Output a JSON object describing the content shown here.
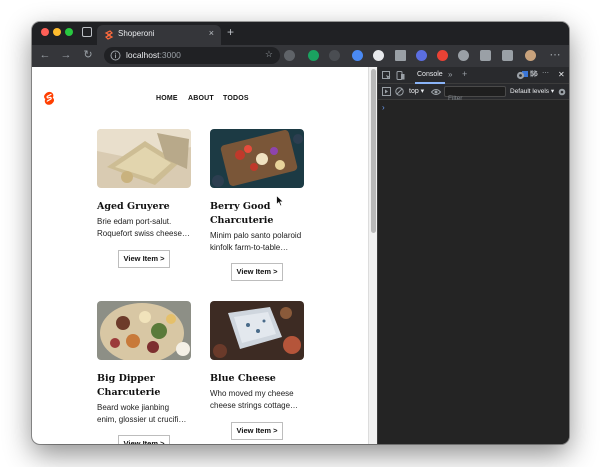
{
  "browser": {
    "tab_title": "Shoperoni",
    "tab_close": "×",
    "new_tab": "+",
    "url_host": "localhost",
    "url_port": ":3000"
  },
  "site": {
    "nav": [
      "HOME",
      "ABOUT",
      "TODOS"
    ],
    "cards": [
      {
        "title": "Aged Gruyere",
        "desc_line1": "Brie edam port-salut.",
        "desc_line2": "Roquefort swiss cheese…",
        "button": "View Item >"
      },
      {
        "title_line1": "Berry Good",
        "title_line2": "Charcuterie",
        "desc_line1": "Minim palo santo polaroid",
        "desc_line2": "kinfolk farm-to-table…",
        "button": "View Item >"
      },
      {
        "title_line1": "Big Dipper",
        "title_line2": "Charcuterie",
        "desc_line1": "Beard woke jianbing",
        "desc_line2": "enim, glossier ut crucifi…",
        "button": "View Item >"
      },
      {
        "title": "Blue Cheese",
        "desc_line1": "Who moved my cheese",
        "desc_line2": "cheese strings cottage…",
        "button": "View Item >"
      }
    ]
  },
  "devtools": {
    "active_tab": "Console",
    "more_tabs": "»",
    "add": "+",
    "issues_count": "56",
    "context": "top",
    "filter_placeholder": "Filter",
    "levels": "Default levels",
    "prompt": "›",
    "close": "✕",
    "menu": "⋯"
  },
  "colors": {
    "brand": "#ff3e00",
    "accent_blue": "#3a76d8"
  }
}
